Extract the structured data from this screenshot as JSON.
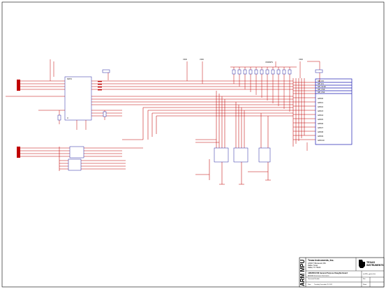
{
  "title_block": {
    "sheet_title": "ARM MPU",
    "company": "Texas Instruments, Inc.",
    "address_1": "12500 TI Boulevard, MS",
    "address_2": "Dallas, Texas",
    "address_3": "Dallas, TX 75243",
    "project": "AM3358 EVM General Purpose Daughterboard",
    "subtitle": "AM3358 Schematic Information",
    "logo_line_1": "TEXAS",
    "logo_line_2": "INSTRUMENTS",
    "doc_label": "Document Number",
    "rev_label": "Rev",
    "date_label": "Date:",
    "date_value": "Tuesday, December 29, 2011",
    "sheet_label": "Sheet",
    "filename": "am335x_gpevm.dsn"
  },
  "colors": {
    "net": "#c00000",
    "component": "#1a1ab0",
    "border": "#000000"
  }
}
